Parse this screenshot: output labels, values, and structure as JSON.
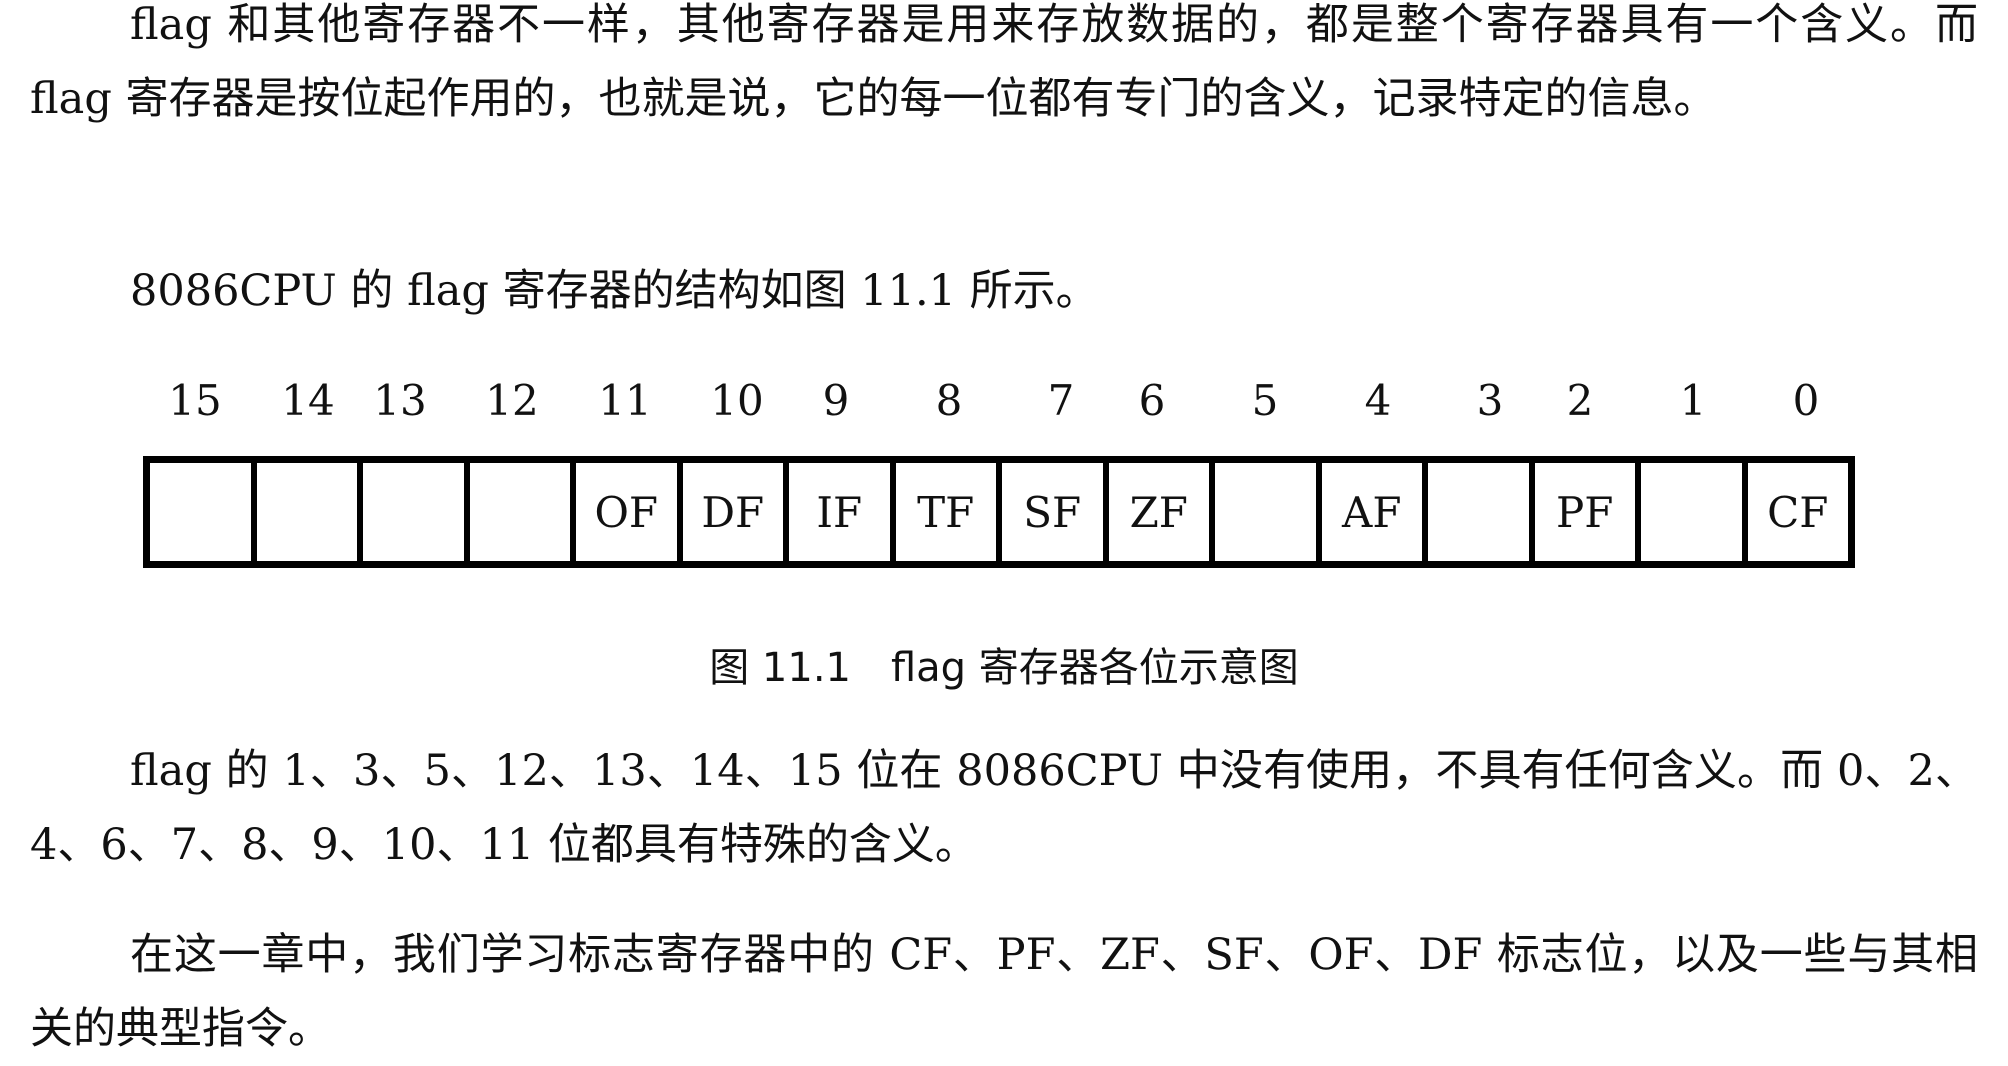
{
  "paragraphs": {
    "p1": "flag 和其他寄存器不一样，其他寄存器是用来存放数据的，都是整个寄存器具有一个含义。而 flag 寄存器是按位起作用的，也就是说，它的每一位都有专门的含义，记录特定的信息。",
    "p2": "8086CPU 的 flag 寄存器的结构如图 11.1 所示。",
    "p3": "flag 的 1、3、5、12、13、14、15 位在 8086CPU 中没有使用，不具有任何含义。而 0、2、4、6、7、8、9、10、11 位都具有特殊的含义。",
    "p4": "在这一章中，我们学习标志寄存器中的 CF、PF、ZF、SF、OF、DF 标志位，以及一些与其相关的典型指令。"
  },
  "figure": {
    "bit_numbers": [
      "15",
      "14",
      "13",
      "12",
      "11",
      "10",
      "9",
      "8",
      "7",
      "6",
      "5",
      "4",
      "3",
      "2",
      "1",
      "0"
    ],
    "cells": [
      "",
      "",
      "",
      "",
      "OF",
      "DF",
      "IF",
      "TF",
      "SF",
      "ZF",
      "",
      "AF",
      "",
      "PF",
      "",
      "CF"
    ],
    "caption": "图 11.1　flag 寄存器各位示意图"
  }
}
